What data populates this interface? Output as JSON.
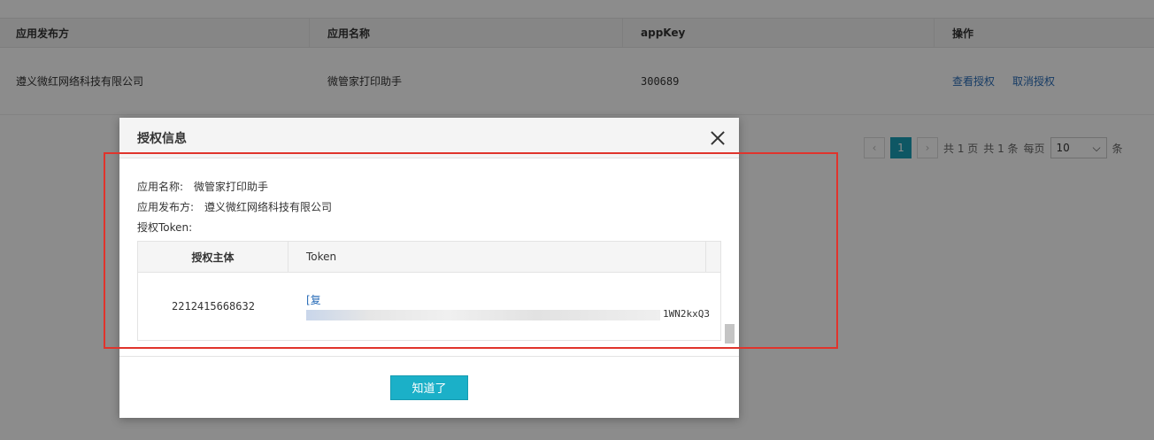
{
  "background_table": {
    "columns": [
      "应用发布方",
      "应用名称",
      "appKey",
      "操作"
    ],
    "row": {
      "publisher": "遵义微红网络科技有限公司",
      "app_name": "微管家打印助手",
      "app_key": "300689",
      "actions": [
        "查看授权",
        "取消授权"
      ]
    }
  },
  "pagination": {
    "prev": "‹",
    "current": "1",
    "next": "›",
    "total_pages_text": "共 1 页",
    "total_items_text": "共 1 条",
    "per_page_label": "每页",
    "per_page_value": "10",
    "trailing": "条"
  },
  "modal": {
    "title": "授权信息",
    "app_name_label": "应用名称:",
    "app_name_value": "微管家打印助手",
    "publisher_label": "应用发布方:",
    "publisher_value": "遵义微红网络科技有限公司",
    "token_label": "授权Token:",
    "token_table": {
      "headers": [
        "授权主体",
        "Token"
      ],
      "subject": "2212415668632",
      "copy_link": "[复",
      "token_tail": "1WN2kxQ3"
    },
    "ok_button": "知道了"
  },
  "colors": {
    "accent": "#1bb0c8",
    "link": "#2a6db8",
    "highlight": "#e0342c"
  }
}
